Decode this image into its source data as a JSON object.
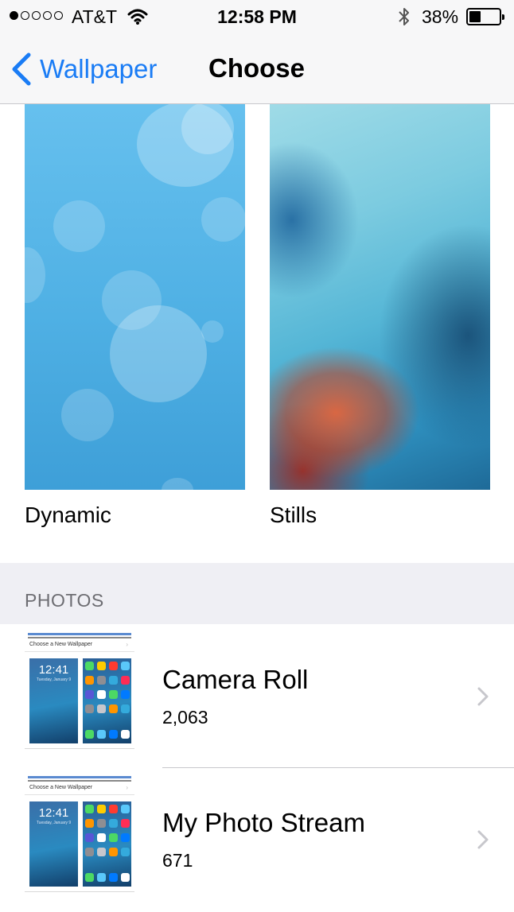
{
  "status_bar": {
    "carrier": "AT&T",
    "time": "12:58 PM",
    "battery": "38%",
    "battery_level": 0.38,
    "signal_bars_filled": 1,
    "signal_bars_total": 5
  },
  "nav": {
    "back_label": "Wallpaper",
    "title": "Choose",
    "accent_color": "#1a7cf5"
  },
  "wallpapers": [
    {
      "label": "Dynamic"
    },
    {
      "label": "Stills"
    }
  ],
  "photos_section": {
    "header": "PHOTOS",
    "albums": [
      {
        "name": "Camera Roll",
        "count": "2,063",
        "thumb_caption": "Choose a New Wallpaper",
        "thumb_time": "12:41",
        "thumb_date": "Tuesday, January 9"
      },
      {
        "name": "My Photo Stream",
        "count": "671",
        "thumb_caption": "Choose a New Wallpaper",
        "thumb_time": "12:41",
        "thumb_date": "Tuesday, January 9"
      }
    ]
  },
  "icons": [
    "wifi-icon",
    "bluetooth-icon",
    "battery-icon",
    "back-chevron-icon",
    "chevron-right-icon"
  ]
}
